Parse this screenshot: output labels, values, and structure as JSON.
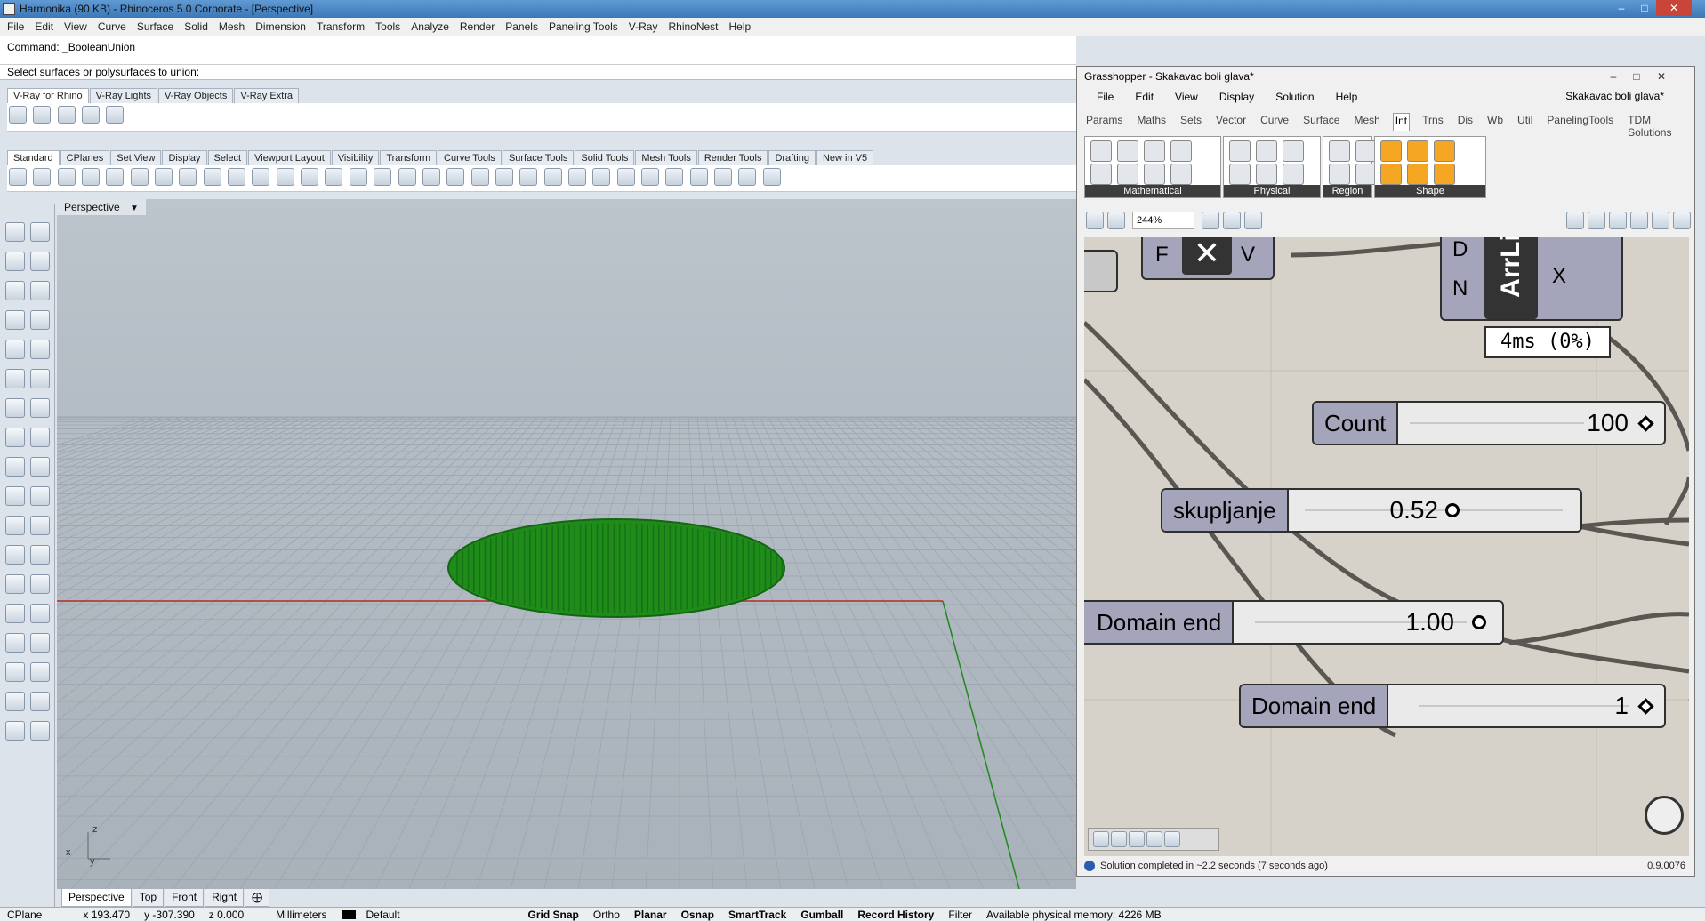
{
  "window": {
    "title": "Harmonika (90 KB) - Rhinoceros  5.0 Corporate - [Perspective]"
  },
  "menu": [
    "File",
    "Edit",
    "View",
    "Curve",
    "Surface",
    "Solid",
    "Mesh",
    "Dimension",
    "Transform",
    "Tools",
    "Analyze",
    "Render",
    "Panels",
    "Paneling Tools",
    "V-Ray",
    "RhinoNest",
    "Help"
  ],
  "command": {
    "history": "Command: _BooleanUnion",
    "prompt": "Select surfaces or polysurfaces to union:"
  },
  "vray_tabs": [
    "V-Ray for Rhino",
    "V-Ray Lights",
    "V-Ray Objects",
    "V-Ray Extra"
  ],
  "toolbar_tabs": [
    "Standard",
    "CPlanes",
    "Set View",
    "Display",
    "Select",
    "Viewport Layout",
    "Visibility",
    "Transform",
    "Curve Tools",
    "Surface Tools",
    "Solid Tools",
    "Mesh Tools",
    "Render Tools",
    "Drafting",
    "New in V5"
  ],
  "viewport": {
    "title": "Perspective",
    "axis_z": "z",
    "axis_x": "x",
    "axis_y": "y",
    "object_color": "#1f8c1a"
  },
  "viewport_tabs": [
    "Perspective",
    "Top",
    "Front",
    "Right"
  ],
  "status": {
    "cplane": "CPlane",
    "x": "x 193.470",
    "y": "y -307.390",
    "z": "z 0.000",
    "units": "Millimeters",
    "layer": "Default",
    "toggles": [
      "Grid Snap",
      "Ortho",
      "Planar",
      "Osnap",
      "SmartTrack",
      "Gumball",
      "Record History",
      "Filter"
    ],
    "memory": "Available physical memory: 4226 MB"
  },
  "grasshopper": {
    "title": "Grasshopper - Skakavac boli glava*",
    "menu": [
      "File",
      "Edit",
      "View",
      "Display",
      "Solution",
      "Help"
    ],
    "document": "Skakavac boli glava*",
    "tabs": [
      "Params",
      "Maths",
      "Sets",
      "Vector",
      "Curve",
      "Surface",
      "Mesh",
      "Int",
      "Trns",
      "Dis",
      "Wb",
      "Util",
      "PanelingTools",
      "TDM Solutions"
    ],
    "active_tab": "Int",
    "groups": [
      "Mathematical",
      "Physical",
      "Region",
      "Shape"
    ],
    "zoom": "244%",
    "canvas": {
      "component_top_inputs": [
        "F",
        "V"
      ],
      "component_right_inputs": [
        "D",
        "N"
      ],
      "component_right_label": "ArrLi",
      "component_right_output": "X",
      "timer": "4ms  (0%)",
      "sliders": [
        {
          "name": "Count",
          "value": "100"
        },
        {
          "name": "skupljanje",
          "value": "0.52"
        },
        {
          "name": "Domain end",
          "value": "1.00"
        },
        {
          "name": "Domain end",
          "value": "1"
        }
      ]
    },
    "status": "Solution completed in ~2.2 seconds (7 seconds ago)",
    "version": "0.9.0076"
  }
}
